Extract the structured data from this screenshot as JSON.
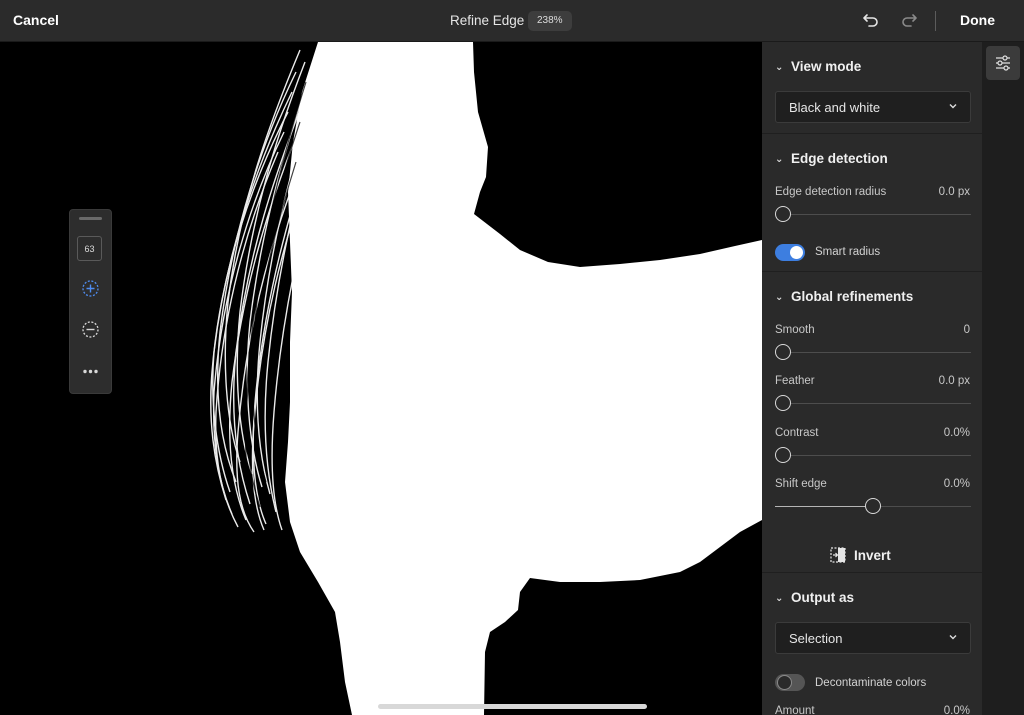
{
  "header": {
    "cancel_label": "Cancel",
    "title": "Refine Edge",
    "zoom": "238%",
    "done_label": "Done"
  },
  "toolstrip": {
    "brush_size": "63",
    "tools": [
      "add-brush-icon",
      "subtract-brush-icon",
      "more-icon"
    ]
  },
  "panel": {
    "view_mode": {
      "heading": "View mode",
      "selected": "Black and white"
    },
    "edge_detection": {
      "heading": "Edge detection",
      "radius_label": "Edge detection radius",
      "radius_value": "0.0 px",
      "radius_fraction": 0,
      "smart_radius_label": "Smart radius",
      "smart_radius_on": true
    },
    "global_refinements": {
      "heading": "Global refinements",
      "sliders": [
        {
          "label": "Smooth",
          "value": "0",
          "fraction": 0
        },
        {
          "label": "Feather",
          "value": "0.0 px",
          "fraction": 0
        },
        {
          "label": "Contrast",
          "value": "0.0%",
          "fraction": 0
        },
        {
          "label": "Shift edge",
          "value": "0.0%",
          "fraction": 0.5
        }
      ],
      "invert_label": "Invert"
    },
    "output": {
      "heading": "Output as",
      "selected": "Selection",
      "decontaminate_label": "Decontaminate colors",
      "decontaminate_on": false,
      "amount_label": "Amount",
      "amount_value": "0.0%"
    }
  },
  "colors": {
    "accent": "#3d7ee0",
    "panel_bg": "#2a2a2a",
    "canvas_bg": "#000000",
    "mask": "#ffffff"
  }
}
